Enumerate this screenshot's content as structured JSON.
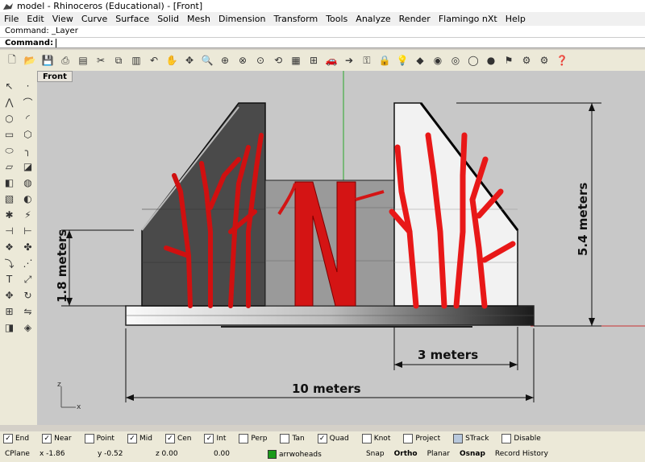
{
  "window": {
    "title": "model - Rhinoceros (Educational) - [Front]"
  },
  "menu": [
    "File",
    "Edit",
    "View",
    "Curve",
    "Surface",
    "Solid",
    "Mesh",
    "Dimension",
    "Transform",
    "Tools",
    "Analyze",
    "Render",
    "Flamingo nXt",
    "Help"
  ],
  "command": {
    "history": "Command: _Layer",
    "prompt": "Command:"
  },
  "viewport": {
    "label": "Front",
    "dims": {
      "height_a": "1.8 meters",
      "height_b": "5.4 meters",
      "width_a": "3 meters",
      "width_b": "10 meters"
    },
    "axis_labels": {
      "z": "z",
      "x": "x"
    }
  },
  "osnap": [
    {
      "label": "End",
      "checked": true
    },
    {
      "label": "Near",
      "checked": true
    },
    {
      "label": "Point",
      "checked": false
    },
    {
      "label": "Mid",
      "checked": true
    },
    {
      "label": "Cen",
      "checked": true
    },
    {
      "label": "Int",
      "checked": true
    },
    {
      "label": "Perp",
      "checked": false
    },
    {
      "label": "Tan",
      "checked": false
    },
    {
      "label": "Quad",
      "checked": true
    },
    {
      "label": "Knot",
      "checked": false
    },
    {
      "label": "Project",
      "checked": false
    },
    {
      "label": "STrack",
      "checked": false
    },
    {
      "label": "Disable",
      "checked": false
    }
  ],
  "status": {
    "cplane": "CPlane",
    "x": "x -1.86",
    "y": "y -0.52",
    "z": "z 0.00",
    "extra": "0.00",
    "layer": "arrwoheads",
    "snap": "Snap",
    "ortho": "Ortho",
    "planar": "Planar",
    "osnap": "Osnap",
    "record": "Record History",
    "layer_color": "#1a9a1a"
  }
}
